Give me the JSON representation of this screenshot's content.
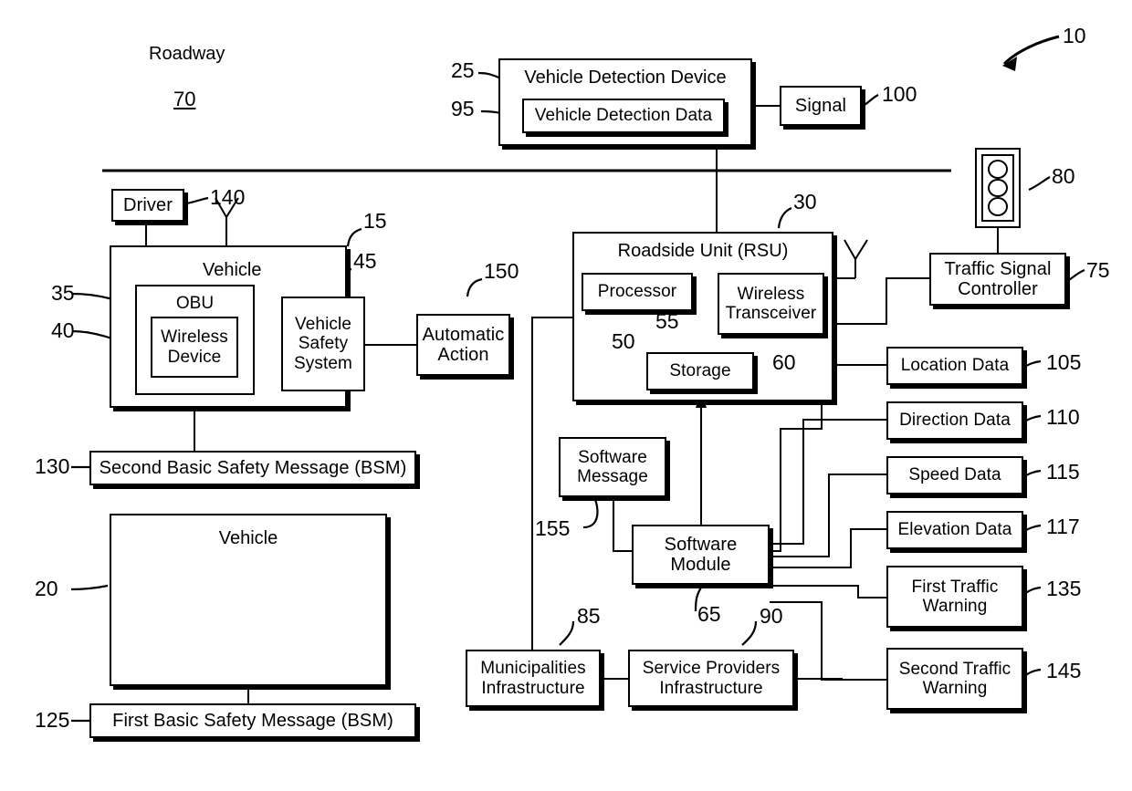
{
  "figure": {
    "system_ref": "10",
    "roadway_label": "Roadway",
    "roadway_ref": "70"
  },
  "nodes": {
    "vehicle_detection_device": {
      "label": "Vehicle Detection Device",
      "ref": "25"
    },
    "vehicle_detection_data": {
      "label": "Vehicle Detection Data",
      "ref": "95"
    },
    "signal": {
      "label": "Signal",
      "ref": "100"
    },
    "traffic_signal_icon": {
      "label": "",
      "ref": "80"
    },
    "traffic_signal_controller": {
      "label": "Traffic Signal Controller",
      "ref": "75"
    },
    "driver": {
      "label": "Driver",
      "ref": "140"
    },
    "vehicle_upper": {
      "label": "Vehicle",
      "ref": "15"
    },
    "obu": {
      "label": "OBU",
      "ref": "35"
    },
    "wireless_device": {
      "label": "Wireless Device",
      "ref": "40"
    },
    "vehicle_safety_system": {
      "label": "Vehicle Safety System",
      "ref": "45"
    },
    "automatic_action": {
      "label": "Automatic Action",
      "ref": "150"
    },
    "second_bsm": {
      "label": "Second Basic Safety Message (BSM)",
      "ref": "130"
    },
    "vehicle_lower": {
      "label": "Vehicle",
      "ref": "20"
    },
    "first_bsm": {
      "label": "First Basic Safety Message (BSM)",
      "ref": "125"
    },
    "roadside_unit": {
      "label": "Roadside Unit (RSU)",
      "ref": "30"
    },
    "processor": {
      "label": "Processor",
      "ref": "50"
    },
    "wireless_transceiver": {
      "label": "Wireless Transceiver",
      "ref": "55"
    },
    "storage": {
      "label": "Storage",
      "ref": "60"
    },
    "software_message": {
      "label": "Software Message",
      "ref": "155"
    },
    "software_module": {
      "label": "Software Module",
      "ref": "65"
    },
    "municipalities": {
      "label": "Municipalities Infrastructure",
      "ref": "85"
    },
    "service_providers": {
      "label": "Service Providers Infrastructure",
      "ref": "90"
    },
    "location_data": {
      "label": "Location Data",
      "ref": "105"
    },
    "direction_data": {
      "label": "Direction Data",
      "ref": "110"
    },
    "speed_data": {
      "label": "Speed Data",
      "ref": "115"
    },
    "elevation_data": {
      "label": "Elevation Data",
      "ref": "117"
    },
    "first_traffic_warning": {
      "label": "First Traffic Warning",
      "ref": "135"
    },
    "second_traffic_warning": {
      "label": "Second Traffic Warning",
      "ref": "145"
    }
  },
  "colors": {
    "line": "#000000",
    "background": "#ffffff"
  }
}
